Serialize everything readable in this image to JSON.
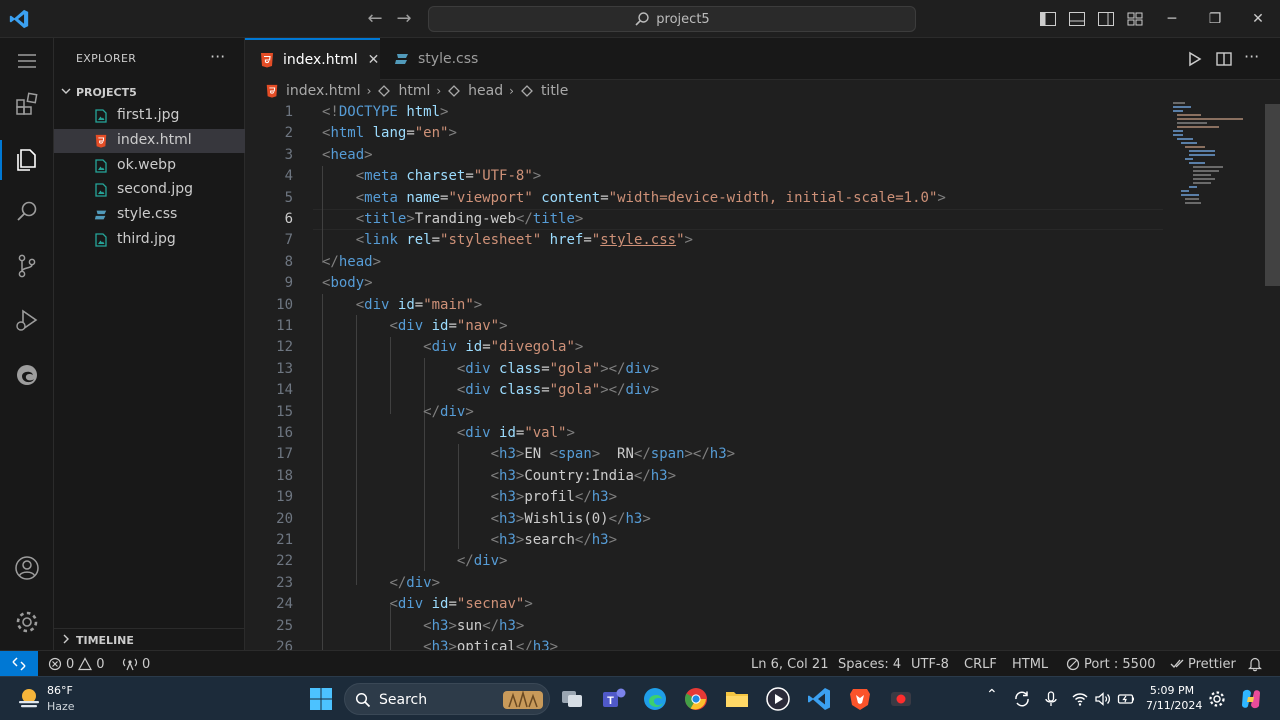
{
  "titlebar": {
    "search_text": "project5",
    "window_controls": [
      "minimize-icon",
      "restore-icon",
      "close-icon"
    ]
  },
  "sidebar": {
    "title": "EXPLORER",
    "more": "···",
    "project": "PROJECT5",
    "files": [
      {
        "name": "first1.jpg",
        "type": "image"
      },
      {
        "name": "index.html",
        "type": "html",
        "active": true
      },
      {
        "name": "ok.webp",
        "type": "image"
      },
      {
        "name": "second.jpg",
        "type": "image"
      },
      {
        "name": "style.css",
        "type": "css"
      },
      {
        "name": "third.jpg",
        "type": "image"
      }
    ],
    "timeline": "TIMELINE"
  },
  "tabs": [
    {
      "label": "index.html",
      "active": true
    },
    {
      "label": "style.css",
      "active": false
    }
  ],
  "breadcrumb": [
    "index.html",
    "html",
    "head",
    "title"
  ],
  "editor": {
    "current_line": 6,
    "lines": [
      {
        "n": "1",
        "parts": [
          [
            "t",
            "<!"
          ],
          [
            "tag",
            "DOCTYPE"
          ],
          [
            "txt",
            " "
          ],
          [
            "attr",
            "html"
          ],
          [
            "t",
            ">"
          ]
        ]
      },
      {
        "n": "2",
        "parts": [
          [
            "t",
            "<"
          ],
          [
            "tag",
            "html"
          ],
          [
            "txt",
            " "
          ],
          [
            "attr",
            "lang"
          ],
          [
            "txt",
            "="
          ],
          [
            "str",
            "\"en\""
          ],
          [
            "t",
            ">"
          ]
        ]
      },
      {
        "n": "3",
        "parts": [
          [
            "t",
            "<"
          ],
          [
            "tag",
            "head"
          ],
          [
            "t",
            ">"
          ]
        ]
      },
      {
        "n": "4",
        "parts": [
          [
            "txt",
            "    "
          ],
          [
            "t",
            "<"
          ],
          [
            "tag",
            "meta"
          ],
          [
            "txt",
            " "
          ],
          [
            "attr",
            "charset"
          ],
          [
            "txt",
            "="
          ],
          [
            "str",
            "\"UTF-8\""
          ],
          [
            "t",
            ">"
          ]
        ]
      },
      {
        "n": "5",
        "parts": [
          [
            "txt",
            "    "
          ],
          [
            "t",
            "<"
          ],
          [
            "tag",
            "meta"
          ],
          [
            "txt",
            " "
          ],
          [
            "attr",
            "name"
          ],
          [
            "txt",
            "="
          ],
          [
            "str",
            "\"viewport\""
          ],
          [
            "txt",
            " "
          ],
          [
            "attr",
            "content"
          ],
          [
            "txt",
            "="
          ],
          [
            "str",
            "\"width=device-width, initial-scale=1.0\""
          ],
          [
            "t",
            ">"
          ]
        ]
      },
      {
        "n": "6",
        "parts": [
          [
            "txt",
            "    "
          ],
          [
            "t",
            "<"
          ],
          [
            "tag",
            "title"
          ],
          [
            "t",
            ">"
          ],
          [
            "txt",
            "Tranding-web"
          ],
          [
            "t",
            "</"
          ],
          [
            "tag",
            "title"
          ],
          [
            "t",
            ">"
          ]
        ]
      },
      {
        "n": "7",
        "parts": [
          [
            "txt",
            "    "
          ],
          [
            "t",
            "<"
          ],
          [
            "tag",
            "link"
          ],
          [
            "txt",
            " "
          ],
          [
            "attr",
            "rel"
          ],
          [
            "txt",
            "="
          ],
          [
            "str",
            "\"stylesheet\""
          ],
          [
            "txt",
            " "
          ],
          [
            "attr",
            "href"
          ],
          [
            "txt",
            "="
          ],
          [
            "str",
            "\""
          ],
          [
            "strlink",
            "style.css"
          ],
          [
            "str",
            "\""
          ],
          [
            "t",
            ">"
          ]
        ]
      },
      {
        "n": "8",
        "parts": [
          [
            "t",
            "</"
          ],
          [
            "tag",
            "head"
          ],
          [
            "t",
            ">"
          ]
        ]
      },
      {
        "n": "9",
        "parts": [
          [
            "t",
            "<"
          ],
          [
            "tag",
            "body"
          ],
          [
            "t",
            ">"
          ]
        ]
      },
      {
        "n": "10",
        "parts": [
          [
            "txt",
            "    "
          ],
          [
            "t",
            "<"
          ],
          [
            "tag",
            "div"
          ],
          [
            "txt",
            " "
          ],
          [
            "attr",
            "id"
          ],
          [
            "txt",
            "="
          ],
          [
            "str",
            "\"main\""
          ],
          [
            "t",
            ">"
          ]
        ]
      },
      {
        "n": "11",
        "parts": [
          [
            "txt",
            "        "
          ],
          [
            "t",
            "<"
          ],
          [
            "tag",
            "div"
          ],
          [
            "txt",
            " "
          ],
          [
            "attr",
            "id"
          ],
          [
            "txt",
            "="
          ],
          [
            "str",
            "\"nav\""
          ],
          [
            "t",
            ">"
          ]
        ]
      },
      {
        "n": "12",
        "parts": [
          [
            "txt",
            "            "
          ],
          [
            "t",
            "<"
          ],
          [
            "tag",
            "div"
          ],
          [
            "txt",
            " "
          ],
          [
            "attr",
            "id"
          ],
          [
            "txt",
            "="
          ],
          [
            "str",
            "\"divegola\""
          ],
          [
            "t",
            ">"
          ]
        ]
      },
      {
        "n": "13",
        "parts": [
          [
            "txt",
            "                "
          ],
          [
            "t",
            "<"
          ],
          [
            "tag",
            "div"
          ],
          [
            "txt",
            " "
          ],
          [
            "attr",
            "class"
          ],
          [
            "txt",
            "="
          ],
          [
            "str",
            "\"gola\""
          ],
          [
            "t",
            "></"
          ],
          [
            "tag",
            "div"
          ],
          [
            "t",
            ">"
          ]
        ]
      },
      {
        "n": "14",
        "parts": [
          [
            "txt",
            "                "
          ],
          [
            "t",
            "<"
          ],
          [
            "tag",
            "div"
          ],
          [
            "txt",
            " "
          ],
          [
            "attr",
            "class"
          ],
          [
            "txt",
            "="
          ],
          [
            "str",
            "\"gola\""
          ],
          [
            "t",
            "></"
          ],
          [
            "tag",
            "div"
          ],
          [
            "t",
            ">"
          ]
        ]
      },
      {
        "n": "15",
        "parts": [
          [
            "txt",
            "            "
          ],
          [
            "t",
            "</"
          ],
          [
            "tag",
            "div"
          ],
          [
            "t",
            ">"
          ]
        ]
      },
      {
        "n": "16",
        "parts": [
          [
            "txt",
            "                "
          ],
          [
            "t",
            "<"
          ],
          [
            "tag",
            "div"
          ],
          [
            "txt",
            " "
          ],
          [
            "attr",
            "id"
          ],
          [
            "txt",
            "="
          ],
          [
            "str",
            "\"val\""
          ],
          [
            "t",
            ">"
          ]
        ]
      },
      {
        "n": "17",
        "parts": [
          [
            "txt",
            "                    "
          ],
          [
            "t",
            "<"
          ],
          [
            "tag",
            "h3"
          ],
          [
            "t",
            ">"
          ],
          [
            "txt",
            "EN "
          ],
          [
            "t",
            "<"
          ],
          [
            "tag",
            "span"
          ],
          [
            "t",
            ">"
          ],
          [
            "txt",
            "  RN"
          ],
          [
            "t",
            "</"
          ],
          [
            "tag",
            "span"
          ],
          [
            "t",
            "></"
          ],
          [
            "tag",
            "h3"
          ],
          [
            "t",
            ">"
          ]
        ]
      },
      {
        "n": "18",
        "parts": [
          [
            "txt",
            "                    "
          ],
          [
            "t",
            "<"
          ],
          [
            "tag",
            "h3"
          ],
          [
            "t",
            ">"
          ],
          [
            "txt",
            "Country:India"
          ],
          [
            "t",
            "</"
          ],
          [
            "tag",
            "h3"
          ],
          [
            "t",
            ">"
          ]
        ]
      },
      {
        "n": "19",
        "parts": [
          [
            "txt",
            "                    "
          ],
          [
            "t",
            "<"
          ],
          [
            "tag",
            "h3"
          ],
          [
            "t",
            ">"
          ],
          [
            "txt",
            "profil"
          ],
          [
            "t",
            "</"
          ],
          [
            "tag",
            "h3"
          ],
          [
            "t",
            ">"
          ]
        ]
      },
      {
        "n": "20",
        "parts": [
          [
            "txt",
            "                    "
          ],
          [
            "t",
            "<"
          ],
          [
            "tag",
            "h3"
          ],
          [
            "t",
            ">"
          ],
          [
            "txt",
            "Wishlis(0)"
          ],
          [
            "t",
            "</"
          ],
          [
            "tag",
            "h3"
          ],
          [
            "t",
            ">"
          ]
        ]
      },
      {
        "n": "21",
        "parts": [
          [
            "txt",
            "                    "
          ],
          [
            "t",
            "<"
          ],
          [
            "tag",
            "h3"
          ],
          [
            "t",
            ">"
          ],
          [
            "txt",
            "search"
          ],
          [
            "t",
            "</"
          ],
          [
            "tag",
            "h3"
          ],
          [
            "t",
            ">"
          ]
        ]
      },
      {
        "n": "22",
        "parts": [
          [
            "txt",
            "                "
          ],
          [
            "t",
            "</"
          ],
          [
            "tag",
            "div"
          ],
          [
            "t",
            ">"
          ]
        ]
      },
      {
        "n": "23",
        "parts": [
          [
            "txt",
            "        "
          ],
          [
            "t",
            "</"
          ],
          [
            "tag",
            "div"
          ],
          [
            "t",
            ">"
          ]
        ]
      },
      {
        "n": "24",
        "parts": [
          [
            "txt",
            "        "
          ],
          [
            "t",
            "<"
          ],
          [
            "tag",
            "div"
          ],
          [
            "txt",
            " "
          ],
          [
            "attr",
            "id"
          ],
          [
            "txt",
            "="
          ],
          [
            "str",
            "\"secnav\""
          ],
          [
            "t",
            ">"
          ]
        ]
      },
      {
        "n": "25",
        "parts": [
          [
            "txt",
            "            "
          ],
          [
            "t",
            "<"
          ],
          [
            "tag",
            "h3"
          ],
          [
            "t",
            ">"
          ],
          [
            "txt",
            "sun"
          ],
          [
            "t",
            "</"
          ],
          [
            "tag",
            "h3"
          ],
          [
            "t",
            ">"
          ]
        ]
      },
      {
        "n": "26",
        "parts": [
          [
            "txt",
            "            "
          ],
          [
            "t",
            "<"
          ],
          [
            "tag",
            "h3"
          ],
          [
            "t",
            ">"
          ],
          [
            "txt",
            "optical"
          ],
          [
            "t",
            "</"
          ],
          [
            "tag",
            "h3"
          ],
          [
            "t",
            ">"
          ]
        ]
      }
    ]
  },
  "statusbar": {
    "errors": "0",
    "warnings": "0",
    "ports": "0",
    "position": "Ln 6, Col 21",
    "spaces": "Spaces: 4",
    "encoding": "UTF-8",
    "eol": "CRLF",
    "language": "HTML",
    "port": "Port : 5500",
    "formatter": "Prettier"
  },
  "taskbar": {
    "weather_temp": "86°F",
    "weather_cond": "Haze",
    "search": "Search",
    "time": "5:09 PM",
    "date": "7/11/2024"
  },
  "colors": {
    "accent": "#0078d4",
    "html_icon": "#e44d26",
    "css_icon": "#519aba",
    "image_icon": "#26a69a"
  }
}
